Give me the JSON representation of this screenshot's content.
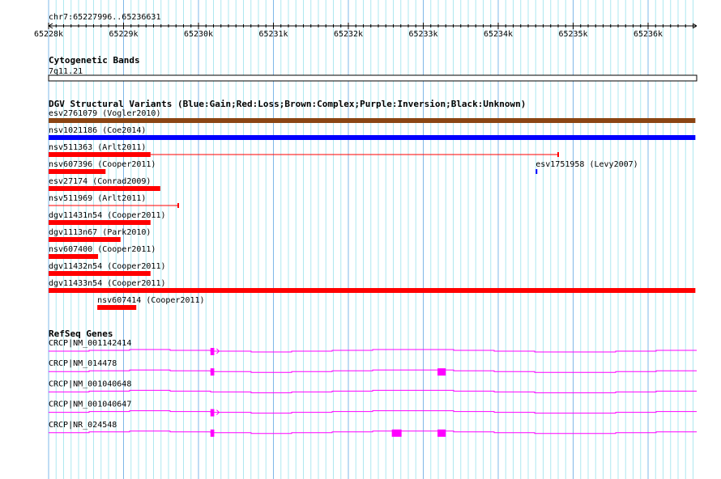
{
  "ruler": {
    "region": "chr7:65227996..65236631",
    "start": 65227996,
    "end": 65236631,
    "ticks": [
      "65228k",
      "65229k",
      "65230k",
      "65231k",
      "65232k",
      "65233k",
      "65234k",
      "65235k",
      "65236k"
    ]
  },
  "cytoband": {
    "title": "Cytogenetic Bands",
    "band": "7q11.21"
  },
  "dgv": {
    "title": "DGV Structural Variants (Blue:Gain;Red:Loss;Brown:Complex;Purple:Inversion;Black:Unknown)",
    "colors": {
      "gain": "#0000ff",
      "loss": "#ff0000",
      "complex": "#8b4513"
    },
    "features": [
      {
        "label": "esv2761079 (Vogler2010)",
        "type": "complex",
        "start": 65227996,
        "end": 65236631,
        "row": 0
      },
      {
        "label": "nsv1021186 (Coe2014)",
        "type": "gain",
        "start": 65227996,
        "end": 65236631,
        "row": 1
      },
      {
        "label": "nsv511363 (Arlt2011)",
        "type": "loss",
        "start": 65227996,
        "end": 65229360,
        "thin_end": 65234800,
        "row": 2
      },
      {
        "label": "nsv607396 (Cooper2011)",
        "type": "loss",
        "start": 65227996,
        "end": 65228760,
        "row": 3
      },
      {
        "label": "esv1751958 (Levy2007)",
        "type": "gain",
        "start": 65234500,
        "end": 65234520,
        "row": 3
      },
      {
        "label": "esv27174 (Conrad2009)",
        "type": "loss",
        "start": 65227996,
        "end": 65229490,
        "row": 4
      },
      {
        "label": "nsv511969 (Arlt2011)",
        "type": "loss",
        "start": 65227996,
        "end": 65227996,
        "thin_end": 65229730,
        "row": 5
      },
      {
        "label": "dgv11431n54 (Cooper2011)",
        "type": "loss",
        "start": 65227996,
        "end": 65229360,
        "row": 6
      },
      {
        "label": "dgv1113n67 (Park2010)",
        "type": "loss",
        "start": 65227996,
        "end": 65228960,
        "row": 7
      },
      {
        "label": "nsv607400 (Cooper2011)",
        "type": "loss",
        "start": 65227996,
        "end": 65228660,
        "row": 8
      },
      {
        "label": "dgv11432n54 (Cooper2011)",
        "type": "loss",
        "start": 65227996,
        "end": 65229360,
        "row": 9
      },
      {
        "label": "dgv11433n54 (Cooper2011)",
        "type": "loss",
        "start": 65227996,
        "end": 65236631,
        "row": 10
      },
      {
        "label": "nsv607414 (Cooper2011)",
        "type": "loss",
        "start": 65228650,
        "end": 65229170,
        "row": 11
      }
    ]
  },
  "refseq": {
    "title": "RefSeq Genes",
    "color": "#ff00ff",
    "genes": [
      {
        "label": "CRCP|NM_001142414",
        "exons": [
          [
            65230160,
            65230210
          ]
        ],
        "arrow": true
      },
      {
        "label": "CRCP|NM_014478",
        "exons": [
          [
            65230160,
            65230210
          ],
          [
            65233190,
            65233300
          ]
        ],
        "arrow": false
      },
      {
        "label": "CRCP|NM_001040648",
        "exons": [],
        "arrow": false
      },
      {
        "label": "CRCP|NM_001040647",
        "exons": [
          [
            65230160,
            65230210
          ]
        ],
        "arrow": true
      },
      {
        "label": "CRCP|NR_024548",
        "exons": [
          [
            65230160,
            65230210
          ],
          [
            65232580,
            65232710
          ],
          [
            65233190,
            65233300
          ]
        ],
        "arrow": false
      }
    ]
  }
}
